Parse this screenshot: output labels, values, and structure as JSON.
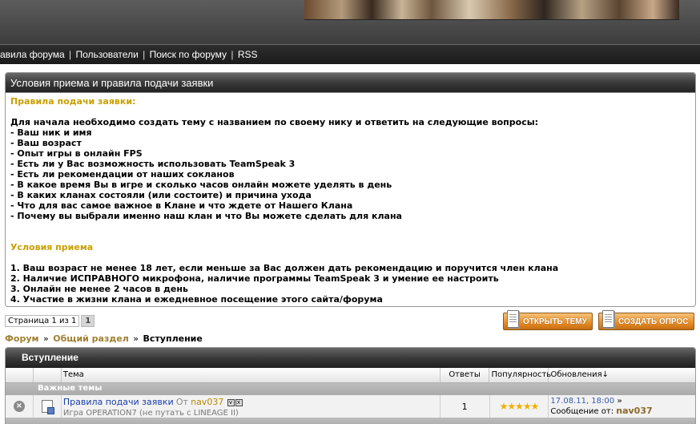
{
  "nav": {
    "links": [
      "авила форума",
      "Пользователи",
      "Поиск по форуму",
      "RSS"
    ],
    "separator": "|"
  },
  "rules": {
    "title": "Условия приема и правила подачи заявки",
    "heading1": "Правила подачи заявки:",
    "intro": "Для начала необходимо создать тему с названием по своему нику и ответить на следующие вопросы:",
    "questions": [
      "- Ваш ник и имя",
      "- Ваш возраст",
      "- Опыт игры в онлайн FPS",
      "- Есть ли у Вас возможность использовать TeamSpeak 3",
      "- Есть ли рекомендации от наших сокланов",
      "- В какое время Вы в игре и сколько часов онлайн можете уделять в день",
      "- В каких кланах состояли (или состоите) и причина ухода",
      "- Что для вас самое важное в Клане и что ждете от Нашего Клана",
      "- Почему вы выбрали именно наш клан и что Вы можете сделать для клана"
    ],
    "heading2": "Условия приема",
    "conditions": [
      "1. Ваш возраст не менее 18 лет, если меньше за Вас должен дать рекомендацию и поручится член клана",
      "2. Наличие ИСПРАВНОГО микрофона, наличие программы TeamSpeak 3 и умение ее настроить",
      "3. Онлайн не менее 2 часов в день",
      "4. Участие в жизни клана и ежедневное посещение этого сайта/форума"
    ]
  },
  "pager": {
    "label": "Страница 1 из 1",
    "current": "1"
  },
  "buttons": {
    "open_topic": "ОТКРЫТЬ ТЕМУ",
    "create_poll": "СОЗДАТЬ ОПРОС"
  },
  "breadcrumb": {
    "forum": "Форум",
    "section": "Общий раздел",
    "current": "Вступление",
    "sep": "»"
  },
  "forum": {
    "title": "Вступление",
    "columns": {
      "topic": "Тема",
      "replies": "Ответы",
      "popularity": "Популярность",
      "updates": "Обновления↓"
    },
    "section": "Важные темы",
    "topic": {
      "title": "Правила подачи заявки",
      "by_label": "От",
      "author": "nav037",
      "description": "Игра OPERATION7 (не путать с LINEAGE II)",
      "replies": "1",
      "stars": "★★★★★",
      "rating": 5,
      "updated_date": "17.08.11, 18:00",
      "updated_arrow": "»",
      "message_label": "Сообщение от:",
      "message_author": "nav037"
    }
  },
  "icons": {
    "status": "closed-topic-icon",
    "topic_type": "document-icon",
    "button_icon": "document-icon"
  },
  "colors": {
    "accent": "#c8a000",
    "link": "#1a3fa8",
    "author": "#b48a00",
    "button": "#e8902a",
    "header_dark": "#2e2e2e"
  }
}
